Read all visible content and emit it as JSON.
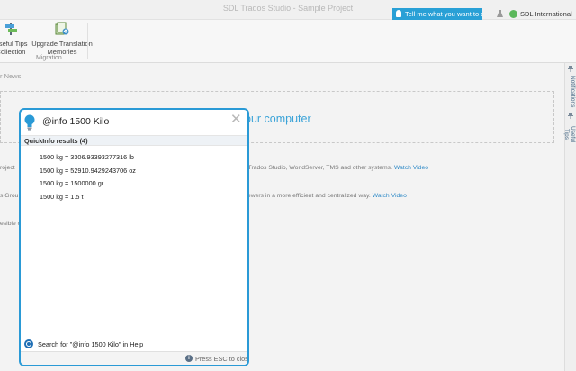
{
  "window": {
    "title": "SDL Trados Studio - Sample Project",
    "tell_me": "Tell me what you want to do...",
    "account": "SDL International"
  },
  "ribbon": {
    "buttons": [
      {
        "label_line1": "Useful Tips",
        "label_line2": "Collection",
        "icon": "tips-icon"
      },
      {
        "label_line1": "Upgrade Translation",
        "label_line2": "Memories",
        "icon": "upgrade-tm-icon"
      }
    ],
    "group_label": "Migration"
  },
  "side_tabs": [
    "Notifications",
    "Useful Tips"
  ],
  "background": {
    "news_tab": "r News",
    "hero_text": "our computer",
    "rows": [
      {
        "prefix": "roject",
        "text": "n Trados Studio, WorldServer, TMS and other systems.",
        "link": "Watch Video"
      },
      {
        "prefix": "s Grou",
        "text": "viewers in a more efficient and centralized way.",
        "link": "Watch Video"
      },
      {
        "prefix": "esible c",
        "text": "",
        "link": ""
      }
    ]
  },
  "popup": {
    "query": "@info 1500 Kilo",
    "results_header": "QuickInfo results (4)",
    "results": [
      "1500 kg = 3306.93393277316 lb",
      "1500 kg = 52910.9429243706 oz",
      "1500 kg = 1500000 gr",
      "1500 kg = 1.5 t"
    ],
    "help_search": "Search for \"@info 1500 Kilo\" in Help",
    "esc_hint": "Press ESC to close"
  },
  "colors": {
    "accent": "#2a9ad6",
    "link": "#2f8ac7",
    "account_badge": "#5cb85c"
  }
}
